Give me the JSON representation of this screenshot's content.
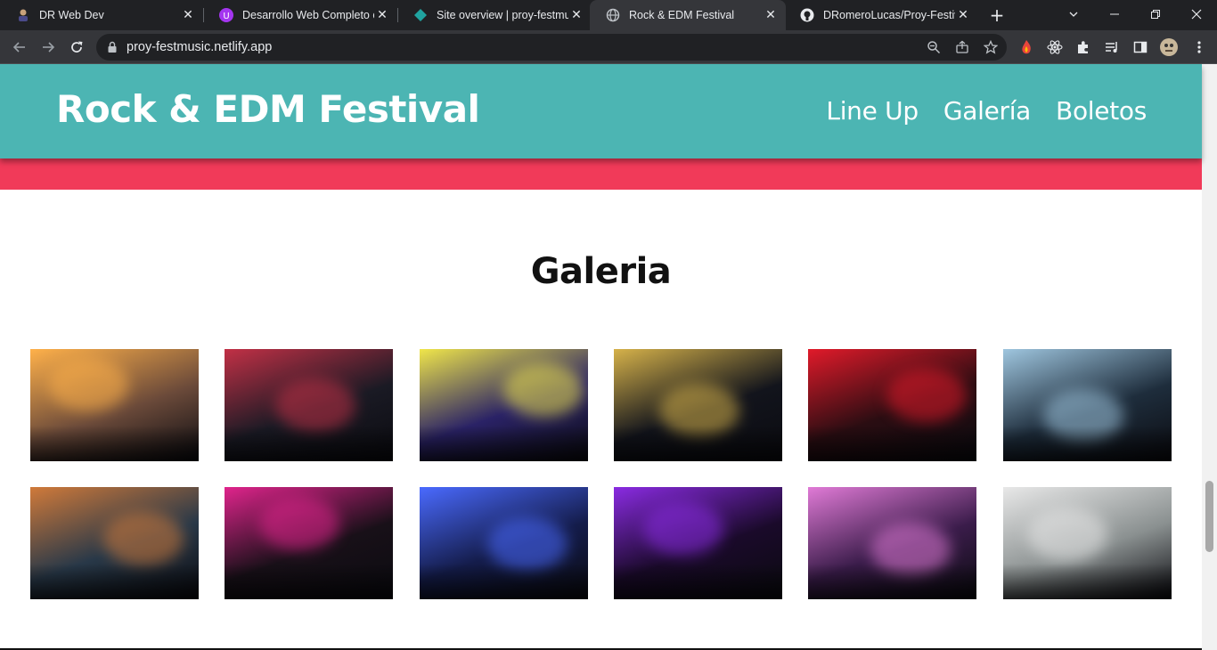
{
  "browser": {
    "tabs": [
      {
        "title": "DR Web Dev",
        "active": false
      },
      {
        "title": "Desarrollo Web Completo co",
        "active": false
      },
      {
        "title": "Site overview | proy-festmusi",
        "active": false
      },
      {
        "title": "Rock & EDM Festival",
        "active": true
      },
      {
        "title": "DRomeroLucas/Proy-Festival",
        "active": false
      }
    ],
    "url": "proy-festmusic.netlify.app"
  },
  "site": {
    "title": "Rock & EDM Festival",
    "nav": [
      "Line Up",
      "Galería",
      "Boletos"
    ],
    "gallery_heading": "Galeria"
  },
  "gallery_images": [
    {
      "name": "crowd-concert-photo",
      "bg": "#6b4a3a",
      "glow": "#ffb14a"
    },
    {
      "name": "rock-singer-photo",
      "bg": "#1a1a24",
      "glow": "#c23046"
    },
    {
      "name": "edm-crowd-photo",
      "bg": "#2a2266",
      "glow": "#f0e64a"
    },
    {
      "name": "dj-turntables-photo",
      "bg": "#12141c",
      "glow": "#d6b24a"
    },
    {
      "name": "guitarist-singer-photo",
      "bg": "#2a0d12",
      "glow": "#e11a2a"
    },
    {
      "name": "female-dj-photo",
      "bg": "#1e2d3c",
      "glow": "#9fc6df"
    },
    {
      "name": "guitarists-closeup-photo",
      "bg": "#283848",
      "glow": "#d07a3a"
    },
    {
      "name": "dj-laptop-photo",
      "bg": "#181018",
      "glow": "#e0248c"
    },
    {
      "name": "dj-mixer-blue-photo",
      "bg": "#141c4a",
      "glow": "#4a6aff"
    },
    {
      "name": "dj-controller-purple-photo",
      "bg": "#1a0a2a",
      "glow": "#8a2be2"
    },
    {
      "name": "singers-stage-photo",
      "bg": "#3a1c4a",
      "glow": "#e07ad6"
    },
    {
      "name": "smoke-performer-photo",
      "bg": "#8a9090",
      "glow": "#e8e8e8"
    }
  ]
}
